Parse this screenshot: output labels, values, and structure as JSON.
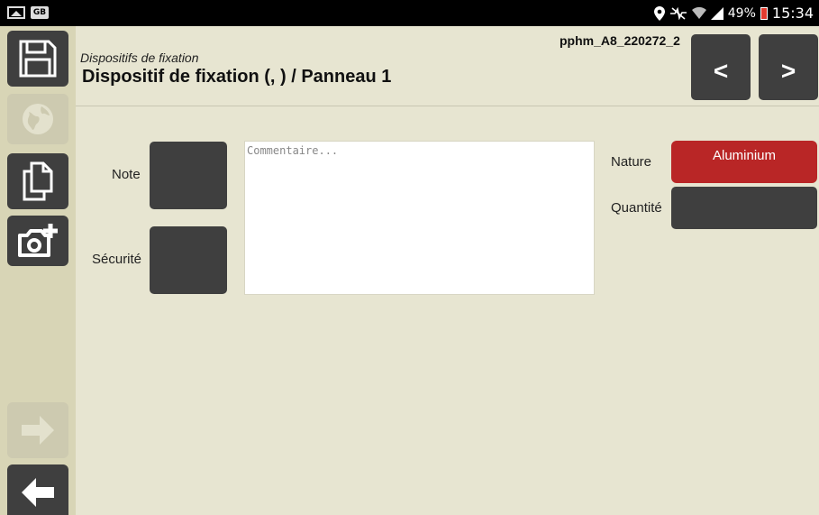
{
  "status_bar": {
    "gb_badge": "GB",
    "battery": "49%",
    "time": "15:34"
  },
  "sidebar": {
    "items": [
      {
        "icon": "save-icon",
        "enabled": true
      },
      {
        "icon": "globe-icon",
        "enabled": false
      },
      {
        "icon": "copy-icon",
        "enabled": true
      },
      {
        "icon": "add-photo-icon",
        "enabled": true
      },
      {
        "icon": "arrow-right-icon",
        "enabled": false
      },
      {
        "icon": "arrow-left-icon",
        "enabled": true
      }
    ]
  },
  "header": {
    "subtitle": "Dispositifs de fixation",
    "title": "Dispositif de fixation (, ) / Panneau 1",
    "record_id": "pphm_A8_220272_2",
    "prev_label": "<",
    "next_label": ">"
  },
  "form": {
    "note_label": "Note",
    "securite_label": "Sécurité",
    "comment_placeholder": "Commentaire...",
    "comment_value": "",
    "nature_label": "Nature",
    "nature_value": "Aluminium",
    "quantite_label": "Quantité",
    "quantite_value": ""
  },
  "colors": {
    "background": "#e7e5d1",
    "sidebar": "#d8d5b6",
    "button": "#3f3f3f",
    "accent_red": "#b92626"
  }
}
